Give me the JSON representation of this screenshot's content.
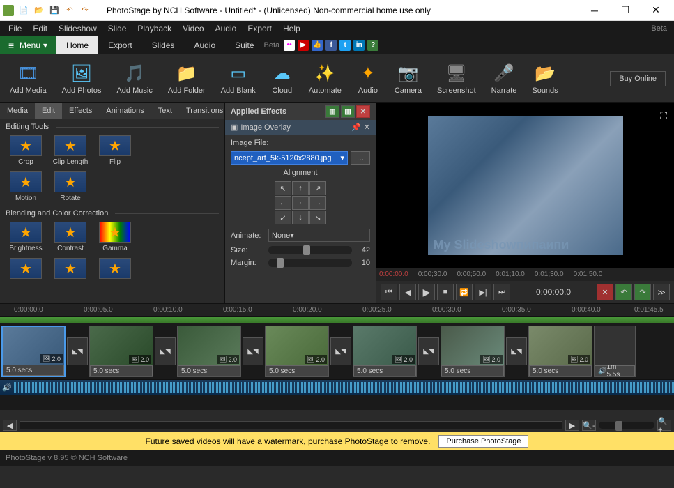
{
  "titlebar": {
    "text": "PhotoStage by NCH Software - Untitled* - (Unlicensed) Non-commercial home use only"
  },
  "menubar": {
    "items": [
      "File",
      "Edit",
      "Slideshow",
      "Slide",
      "Playback",
      "Video",
      "Audio",
      "Export",
      "Help"
    ],
    "beta": "Beta"
  },
  "ribbon": {
    "menu": "Menu",
    "tabs": [
      "Home",
      "Export",
      "Slides",
      "Audio",
      "Suite"
    ],
    "active": 0,
    "beta": "Beta"
  },
  "toolbar": {
    "buttons": [
      "Add Media",
      "Add Photos",
      "Add Music",
      "Add Folder",
      "Add Blank",
      "Cloud",
      "Automate",
      "Audio",
      "Camera",
      "Screenshot",
      "Narrate",
      "Sounds"
    ],
    "buy": "Buy Online"
  },
  "subtabs": {
    "items": [
      "Media",
      "Edit",
      "Effects",
      "Animations",
      "Text",
      "Transitions"
    ],
    "active": 1
  },
  "editingTools": {
    "title": "Editing Tools",
    "items": [
      "Crop",
      "Clip Length",
      "Flip",
      "Motion",
      "Rotate"
    ]
  },
  "blending": {
    "title": "Blending and Color Correction",
    "items": [
      "Brightness",
      "Contrast",
      "Gamma"
    ]
  },
  "effects": {
    "header": "Applied Effects",
    "section": "Image Overlay",
    "fileLabel": "Image File:",
    "fileName": "ncept_art_5k-5120x2880.jpg",
    "alignLabel": "Alignment",
    "animateLabel": "Animate:",
    "animateValue": "None",
    "sizeLabel": "Size:",
    "sizeValue": "42",
    "marginLabel": "Margin:",
    "marginValue": "10"
  },
  "preview": {
    "overlayText": "My Slideshowпипаипи",
    "rulerTimes": [
      "0:00:00.0",
      "0:00;30.0",
      "0:00;50.0",
      "0:01;10.0",
      "0:01;30.0",
      "0:01;50.0"
    ],
    "currentTime": "0:00:00.0"
  },
  "timeline": {
    "ticks": [
      "0:00:00.0",
      "0:00:05.0",
      "0:00:10.0",
      "0:00:15.0",
      "0:00:20.0",
      "0:00:25.0",
      "0:00:30.0",
      "0:00:35.0",
      "0:00:40.0",
      "0:01:45.5"
    ],
    "clipDuration": "5.0 secs",
    "transitionDur": "2.0",
    "audioDuration": "1m 5.5s"
  },
  "banner": {
    "text": "Future saved videos will have a watermark, purchase PhotoStage to remove.",
    "button": "Purchase PhotoStage"
  },
  "statusbar": {
    "text": "PhotoStage v 8.95 © NCH Software"
  }
}
